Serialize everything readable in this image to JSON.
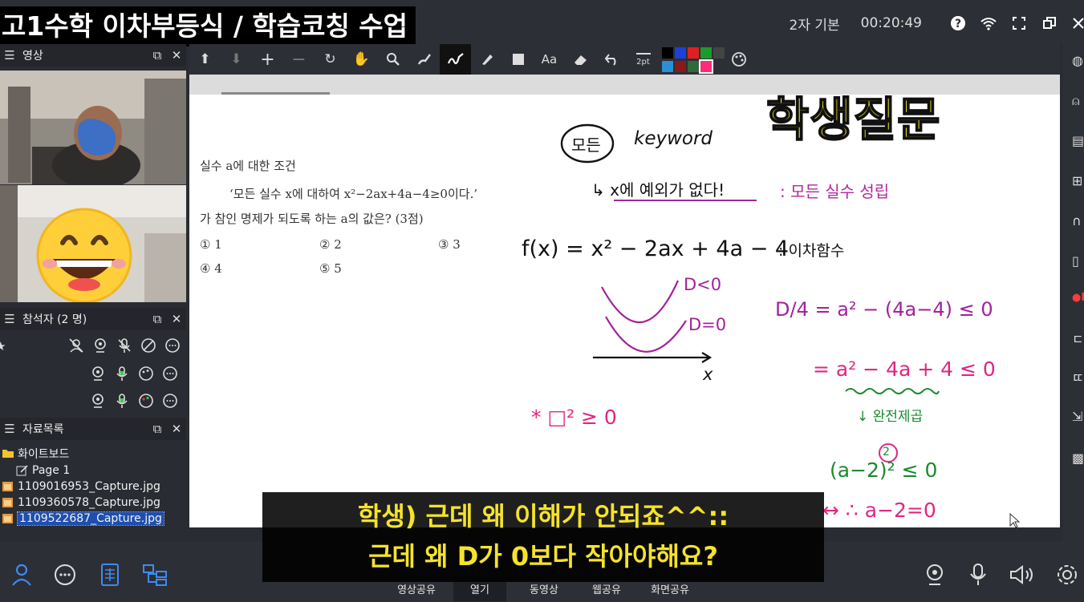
{
  "window": {
    "title": "고1수학 이차부등식 / 학습코칭 수업",
    "mode": "2자 기본",
    "timer": "00:20:49"
  },
  "panels": {
    "video": {
      "label": "영상"
    },
    "participants": {
      "label": "참석자 (2 명)"
    },
    "materials": {
      "label": "자료목록",
      "folder": "화이트보드",
      "page": "Page 1",
      "files": [
        "1109016953_Capture.jpg",
        "1109360578_Capture.jpg",
        "1109522687_Capture.jpg"
      ],
      "selected_index": 2
    }
  },
  "toolbar": {
    "text_label": "Aa",
    "pen_size": "2pt",
    "palette": [
      "#000000",
      "#1e3fd8",
      "#e02020",
      "#1d9a2c",
      "#444444",
      "#2a8fd6",
      "#8a1a1a",
      "#2f6a3a",
      "#ff2a7d"
    ]
  },
  "problem": {
    "heading": "실수 a에 대한 조건",
    "condition": "‘모든 실수 x에 대하여 x²−2ax+4a−4≥0이다.’",
    "question": "가 참인 명제가 되도록 하는 a의 값은? (3점)",
    "choices": [
      "① 1",
      "② 2",
      "③ 3",
      "④ 4",
      "⑤ 5"
    ]
  },
  "handwriting": {
    "banner": "학생질문",
    "circled": "모든",
    "keyword": "keyword",
    "arrow_note": "↳ x에 예외가 없다!",
    "meaning": ": 모든 실수 성립",
    "function": "f(x) = x² − 2ax + 4a − 4",
    "function_type": ": 이차함수",
    "d_neg": "D<0",
    "d_zero": "D=0",
    "axis_x": "x",
    "d4": "D/4 = a² − (4a−4) ≤ 0",
    "step2": "= a² − 4a + 4 ≤ 0",
    "perfect_square": "↓ 완전제곱",
    "step3": "(a−2)² ≤ 0",
    "square_exp": "2",
    "step4": "↔ ∴ a−2=0",
    "note": "* □² ≥ 0"
  },
  "subtitle": {
    "line1": "학생) 근데 왜 이해가 안되죠^^::",
    "line2": "근데 왜 D가 0보다 작아야해요?"
  },
  "bottom_tabs": [
    "영상공유",
    "열기",
    "동영상",
    "웹공유",
    "화면공유"
  ],
  "selected_tab": 1
}
